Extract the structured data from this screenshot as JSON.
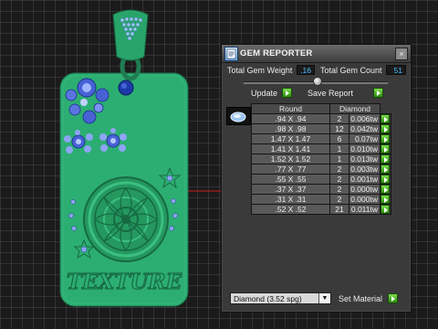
{
  "window": {
    "title": "GEM REPORTER",
    "close_glyph": "×"
  },
  "summary": {
    "total_weight_label": "Total Gem Weight",
    "total_weight_value": ".16",
    "total_count_label": "Total Gem Count",
    "total_count_value": "51"
  },
  "actions": {
    "update_label": "Update",
    "save_report_label": "Save Report",
    "set_material_label": "Set Material"
  },
  "table": {
    "headers": [
      "Round",
      "Diamond"
    ],
    "rows": [
      {
        "size": ".94 X .94",
        "count": "2",
        "weight": "0.006tw"
      },
      {
        "size": ".98 X .98",
        "count": "12",
        "weight": "0.042tw"
      },
      {
        "size": "1.47 X 1.47",
        "count": "6",
        "weight": "0.07tw"
      },
      {
        "size": "1.41 X 1.41",
        "count": "1",
        "weight": "0.010tw"
      },
      {
        "size": "1.52 X 1.52",
        "count": "1",
        "weight": "0.013tw"
      },
      {
        "size": ".77 X .77",
        "count": "2",
        "weight": "0.003tw"
      },
      {
        "size": ".55 X .55",
        "count": "2",
        "weight": "0.001tw"
      },
      {
        "size": ".37 X .37",
        "count": "2",
        "weight": "0.000tw"
      },
      {
        "size": ".31 X .31",
        "count": "2",
        "weight": "0.000tw"
      },
      {
        "size": ".52 X .52",
        "count": "21",
        "weight": "0.011tw"
      }
    ]
  },
  "material": {
    "selected": "Diamond    (3.52 spg)"
  },
  "model": {
    "engraved_text": "TEXTURE",
    "colors": {
      "metal": "#2cae72",
      "metal_dark": "#1d7a4f",
      "gem_blue": "#4a63d8",
      "bail": "#28a46a"
    }
  },
  "icons": [
    "gem-report-app-icon",
    "close-icon",
    "round-gem-icon",
    "dropdown-arrow-icon",
    "green-arrow-icon"
  ]
}
